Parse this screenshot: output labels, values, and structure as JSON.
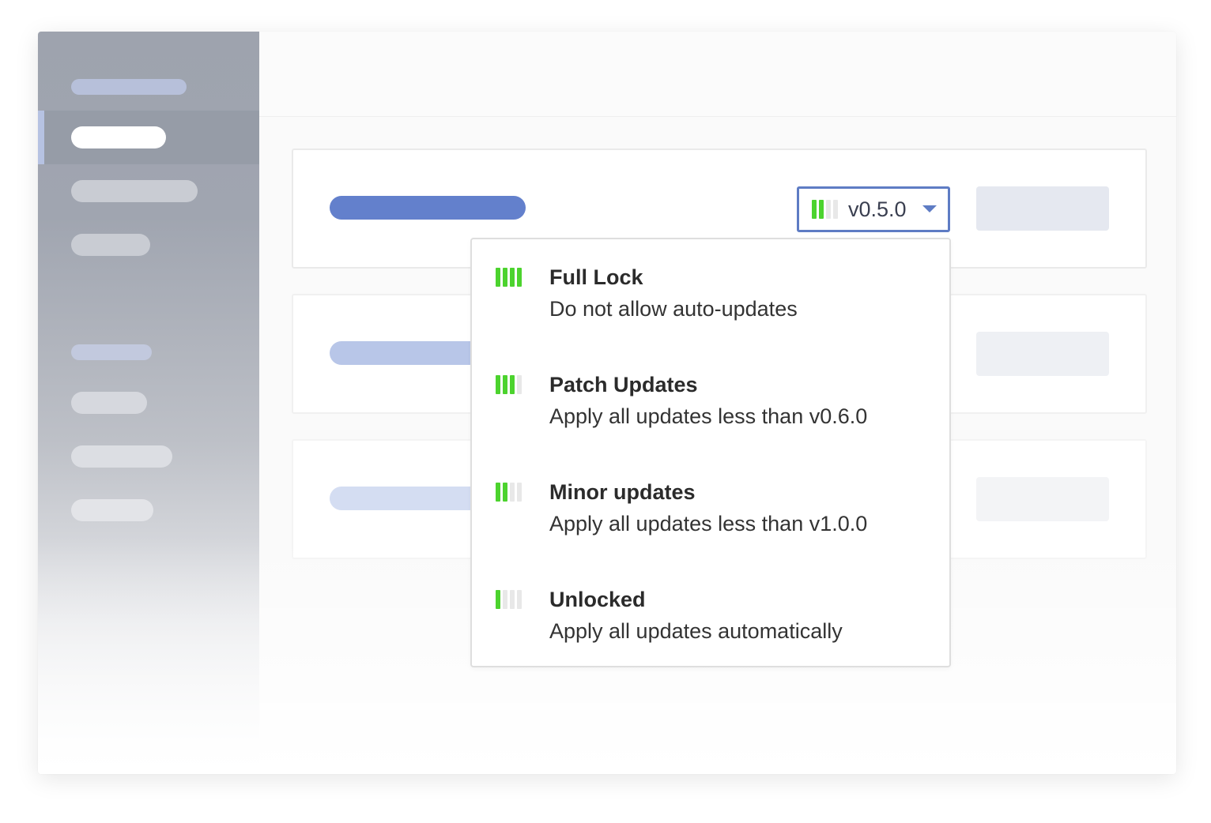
{
  "colors": {
    "accent": "#5e7cc4",
    "lock_bar_on": "#4cd32e",
    "lock_bar_off": "#e8e8e8",
    "sidebar_top": "#9ea3ae"
  },
  "version_select": {
    "value": "v0.5.0",
    "lock_level_bars_on": 2,
    "lock_level_bars_total": 4,
    "icon": "chevron-down-icon"
  },
  "lock_options": [
    {
      "title": "Full Lock",
      "description": "Do not allow auto-updates",
      "bars_on": 4
    },
    {
      "title": "Patch Updates",
      "description": "Apply all updates less than v0.6.0",
      "bars_on": 3
    },
    {
      "title": "Minor updates",
      "description": "Apply all updates less than v1.0.0",
      "bars_on": 2
    },
    {
      "title": "Unlocked",
      "description": "Apply all updates automatically",
      "bars_on": 1
    }
  ]
}
